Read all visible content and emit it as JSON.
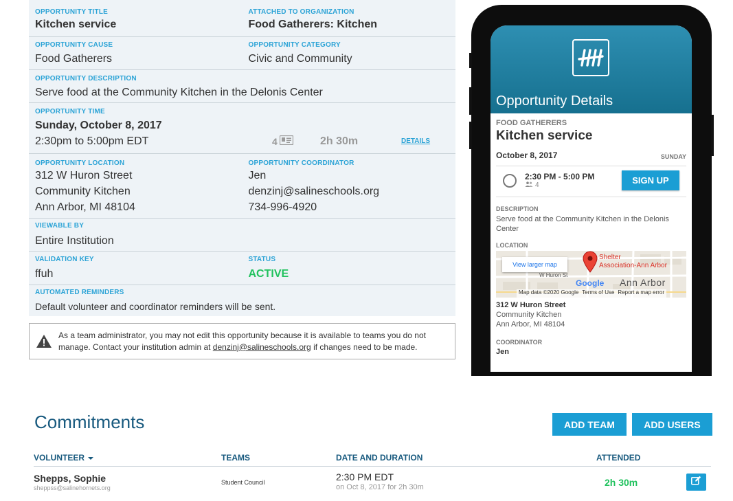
{
  "details": {
    "title_label": "OPPORTUNITY TITLE",
    "title_value": "Kitchen service",
    "org_label": "ATTACHED TO ORGANIZATION",
    "org_value": "Food Gatherers: Kitchen",
    "cause_label": "OPPORTUNITY CAUSE",
    "cause_value": "Food Gatherers",
    "category_label": "OPPORTUNITY CATEGORY",
    "category_value": "Civic and Community",
    "description_label": "OPPORTUNITY DESCRIPTION",
    "description_value": "Serve food at the Community Kitchen in the Delonis Center",
    "time_label": "OPPORTUNITY TIME",
    "time_date": "Sunday, October 8, 2017",
    "time_range": "2:30pm to 5:00pm EDT",
    "time_capacity": "4",
    "time_duration": "2h 30m",
    "time_details_link": "DETAILS",
    "location_label": "OPPORTUNITY LOCATION",
    "location_line1": "312 W Huron Street",
    "location_line2": "Community Kitchen",
    "location_line3": "Ann Arbor, MI 48104",
    "coordinator_label": "OPPORTUNITY COORDINATOR",
    "coordinator_name": "Jen",
    "coordinator_email": "denzinj@salineschools.org",
    "coordinator_phone": "734-996-4920",
    "viewable_label": "VIEWABLE BY",
    "viewable_value": "Entire Institution",
    "validation_label": "VALIDATION KEY",
    "validation_value": "ffuh",
    "status_label": "STATUS",
    "status_value": "ACTIVE",
    "reminders_label": "AUTOMATED REMINDERS",
    "reminders_value": "Default volunteer and coordinator reminders will be sent."
  },
  "notice": {
    "text_before": "As a team administrator, you may not edit this opportunity because it is available to teams you do not manage. Contact your institution admin at ",
    "email": "denzinj@salineschools.org",
    "text_after": " if changes need to be made."
  },
  "phone": {
    "header_title": "Opportunity Details",
    "org": "FOOD GATHERERS",
    "name": "Kitchen service",
    "date": "October 8, 2017",
    "day": "SUNDAY",
    "shift_time": "2:30 PM - 5:00 PM",
    "shift_capacity": "4",
    "signup_label": "SIGN UP",
    "description_label": "DESCRIPTION",
    "description": "Serve food at the Community Kitchen in the Delonis Center",
    "location_label": "LOCATION",
    "map_button": "View larger map",
    "map_street": "W Huron St",
    "map_poi_line1": "Shelter",
    "map_poi_line2": "Association-Ann Arbor",
    "map_city": "Ann Arbor",
    "map_brand": "Google",
    "map_data": "Map data ©2020 Google",
    "map_terms": "Terms of Use",
    "map_report": "Report a map error",
    "address_line1": "312 W Huron Street",
    "address_line2": "Community Kitchen",
    "address_line3": "Ann Arbor, MI 48104",
    "coordinator_label": "COORDINATOR",
    "coordinator_name": "Jen"
  },
  "commitments": {
    "title": "Commitments",
    "add_team_label": "ADD TEAM",
    "add_users_label": "ADD USERS",
    "columns": {
      "volunteer": "VOLUNTEER",
      "teams": "TEAMS",
      "date_duration": "DATE AND DURATION",
      "attended": "ATTENDED"
    },
    "rows": [
      {
        "name": "Shepps, Sophie",
        "email": "sheppss@salinehornets.org",
        "team": "Student Council",
        "time": "2:30 PM EDT",
        "duration": "on Oct 8, 2017 for 2h 30m",
        "attended": "2h 30m"
      }
    ]
  },
  "colors": {
    "accent": "#1b9ed4",
    "label": "#2ba3d6",
    "heading": "#17597e",
    "active": "#21c25e",
    "panel": "#eef3f7"
  }
}
